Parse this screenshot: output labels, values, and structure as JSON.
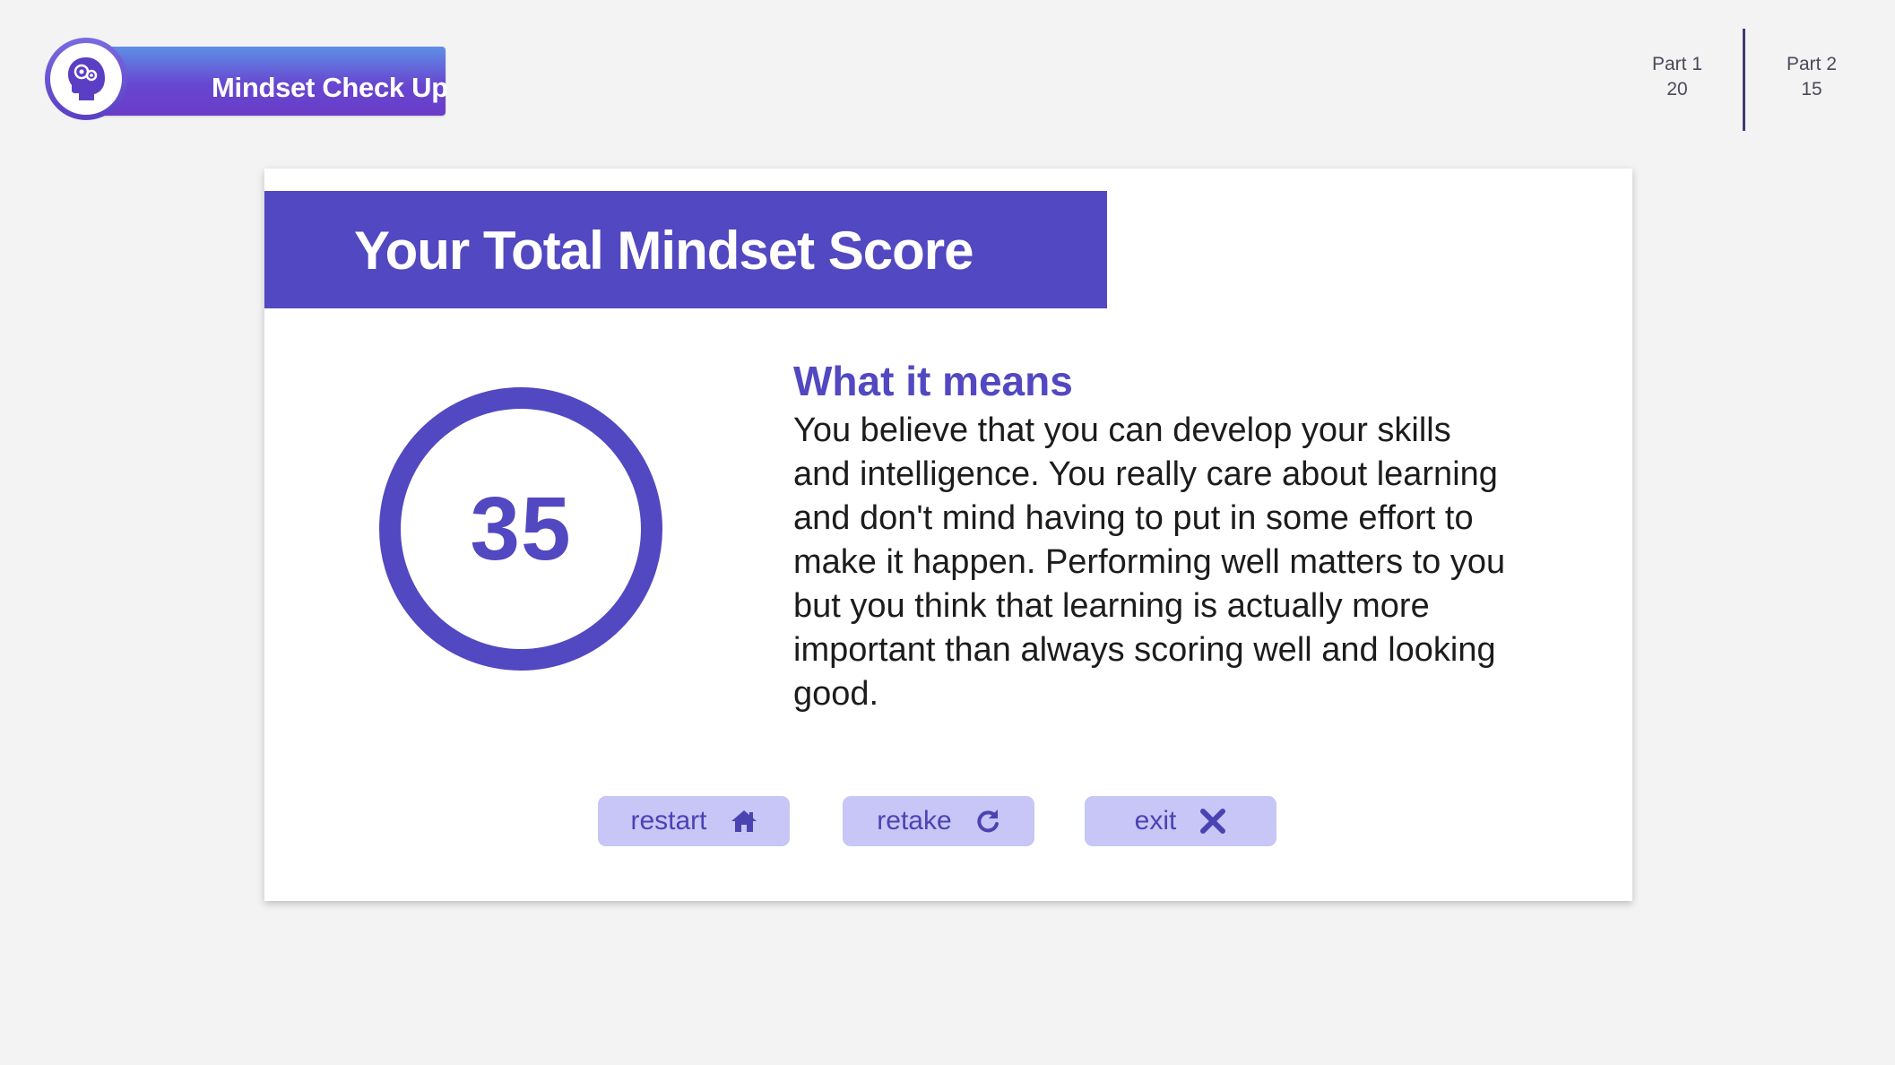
{
  "app": {
    "title": "Mindset Check Up"
  },
  "parts": [
    {
      "label": "Part 1",
      "score": "20"
    },
    {
      "label": "Part 2",
      "score": "15"
    }
  ],
  "result": {
    "banner_title": "Your Total Mindset Score",
    "score": "35",
    "meaning_heading": "What it means",
    "meaning_text": "You believe that you can develop your skills and intelligence. You really care about learning and don't mind having to put in some effort to make it happen. Performing well matters to you but you think that learning is actually more important than always scoring well and looking good."
  },
  "actions": {
    "restart": {
      "label": "restart",
      "icon": "home-icon"
    },
    "retake": {
      "label": "retake",
      "icon": "refresh-icon"
    },
    "exit": {
      "label": "exit",
      "icon": "close-icon"
    }
  },
  "colors": {
    "accent": "#5248c1",
    "button_bg": "#c7c6f6",
    "background": "#f3f3f3",
    "card": "#ffffff"
  }
}
